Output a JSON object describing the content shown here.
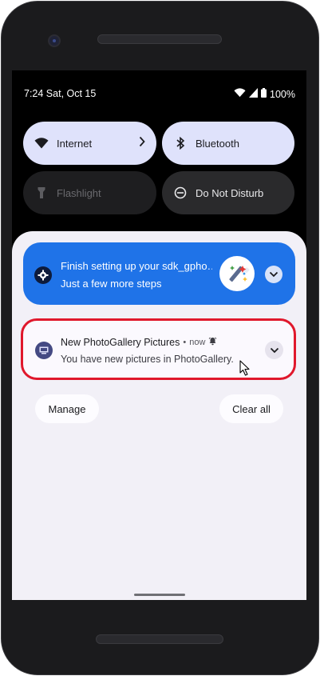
{
  "status_bar": {
    "time_date": "7:24 Sat, Oct 15",
    "battery": "100%"
  },
  "quick_settings": [
    {
      "label": "Internet",
      "icon": "wifi-icon",
      "state": "on"
    },
    {
      "label": "Bluetooth",
      "icon": "bluetooth-icon",
      "state": "on"
    },
    {
      "label": "Flashlight",
      "icon": "flashlight-icon",
      "state": "unavailable"
    },
    {
      "label": "Do Not Disturb",
      "icon": "do-not-disturb-icon",
      "state": "off"
    }
  ],
  "notifications": [
    {
      "title": "Finish setting up your sdk_gpho…",
      "text": "Just a few more steps",
      "icon": "gear-icon",
      "color": "#1f73e8"
    },
    {
      "title": "New PhotoGallery Pictures",
      "separator": "•",
      "time": "now",
      "text": "You have new pictures in PhotoGallery.",
      "icon": "photo-app-icon"
    }
  ],
  "actions": {
    "manage": "Manage",
    "clear_all": "Clear all"
  },
  "colors": {
    "highlight": "#e0182c",
    "tile_on": "#dfe2fb",
    "shade": "#f2f0f7"
  }
}
